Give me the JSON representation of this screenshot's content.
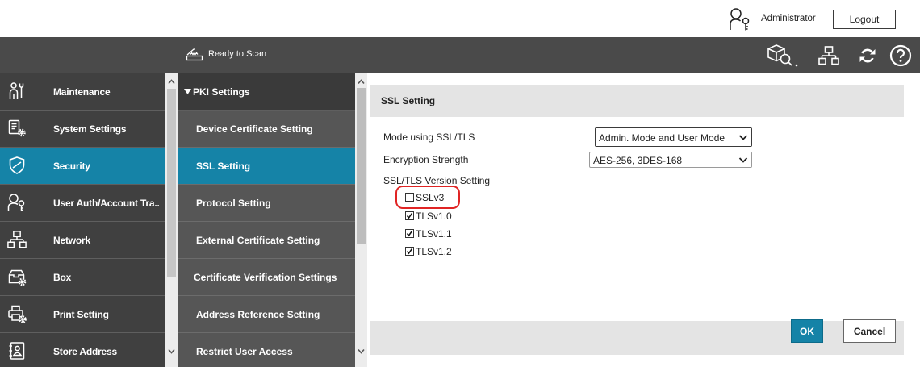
{
  "topbar": {
    "user_icon": "user-key-icon",
    "user_name": "Administrator",
    "logout_label": "Logout"
  },
  "statusbar": {
    "scanner_icon": "scanner-icon",
    "status_text": "Ready to Scan",
    "tool_icons": [
      "box-search-icon",
      "network-icon",
      "refresh-icon",
      "help-icon"
    ]
  },
  "sidebar": {
    "items": [
      {
        "label": "Maintenance",
        "icon": "maintenance-icon",
        "active": false
      },
      {
        "label": "System Settings",
        "icon": "system-settings-icon",
        "active": false
      },
      {
        "label": "Security",
        "icon": "shield-icon",
        "active": true
      },
      {
        "label": "User Auth/Account Tra..",
        "icon": "user-auth-icon",
        "active": false
      },
      {
        "label": "Network",
        "icon": "network-icon",
        "active": false
      },
      {
        "label": "Box",
        "icon": "box-icon",
        "active": false
      },
      {
        "label": "Print Setting",
        "icon": "print-setting-icon",
        "active": false
      },
      {
        "label": "Store Address",
        "icon": "address-book-icon",
        "active": false
      }
    ]
  },
  "submenu": {
    "header_icon": "expand-triangle-icon",
    "header_label": "PKI Settings",
    "items": [
      {
        "label": "Device Certificate Setting",
        "active": false
      },
      {
        "label": "SSL Setting",
        "active": true
      },
      {
        "label": "Protocol Setting",
        "active": false
      },
      {
        "label": "External Certificate Setting",
        "active": false
      },
      {
        "label": "Certificate Verification Settings",
        "active": false
      },
      {
        "label": "Address Reference Setting",
        "active": false
      },
      {
        "label": "Restrict User Access",
        "active": false
      }
    ]
  },
  "main": {
    "title": "SSL Setting",
    "mode": {
      "label": "Mode using SSL/TLS",
      "value": "Admin. Mode and User Mode"
    },
    "encryption": {
      "label": "Encryption Strength",
      "value": "AES-256, 3DES-168"
    },
    "versions": {
      "label": "SSL/TLS Version Setting",
      "options": [
        {
          "label": "SSLv3",
          "checked": false,
          "highlighted": true
        },
        {
          "label": "TLSv1.0",
          "checked": true
        },
        {
          "label": "TLSv1.1",
          "checked": true
        },
        {
          "label": "TLSv1.2",
          "checked": true
        }
      ]
    },
    "ok_label": "OK",
    "cancel_label": "Cancel"
  },
  "colors": {
    "accent": "#1583a7",
    "sidebar_bg": "#404040",
    "submenu_bg": "#565656",
    "statusbar_bg": "#4a4a4a",
    "panel_header_bg": "#e4e4e4",
    "annotation_red": "#e02424"
  }
}
